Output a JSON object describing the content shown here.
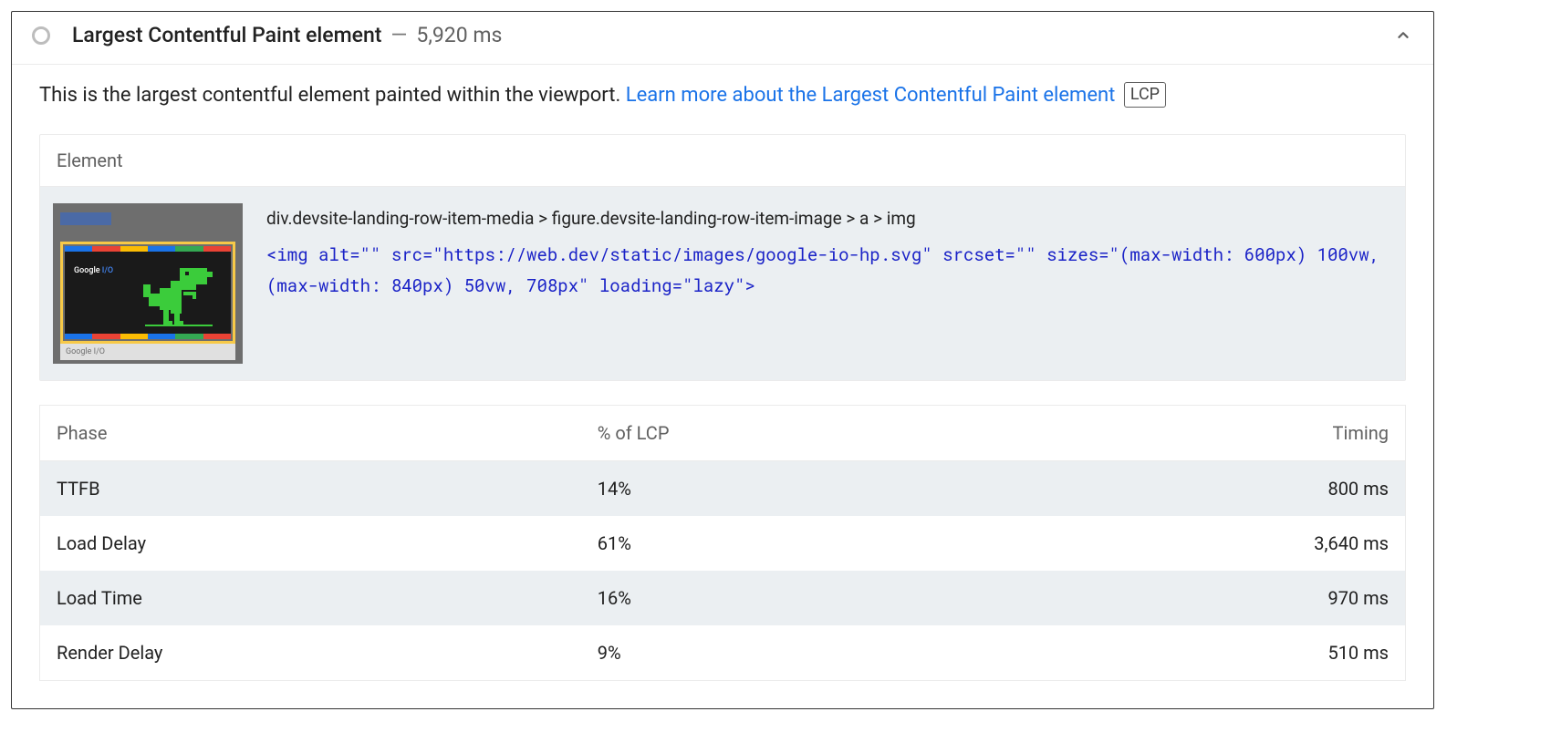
{
  "header": {
    "title": "Largest Contentful Paint element",
    "separator": "—",
    "metric": "5,920 ms"
  },
  "description": {
    "text": "This is the largest contentful element painted within the viewport. ",
    "link_text": "Learn more about the Largest Contentful Paint element",
    "badge": "LCP"
  },
  "element_card": {
    "header": "Element",
    "selector_path": "div.devsite-landing-row-item-media > figure.devsite-landing-row-item-image > a > img",
    "html_snippet": "<img alt=\"\" src=\"https://web.dev/static/images/google-io-hp.svg\" srcset=\"\" sizes=\"(max-width: 600px) 100vw, (max-width: 840px) 50vw, 708px\" loading=\"lazy\">",
    "thumb_logo_text": "Google",
    "thumb_logo_io": " I/O",
    "thumb_caption": "Google I/O"
  },
  "phase_table": {
    "columns": {
      "phase": "Phase",
      "pct": "% of LCP",
      "timing": "Timing"
    },
    "rows": [
      {
        "phase": "TTFB",
        "pct": "14%",
        "timing": "800 ms"
      },
      {
        "phase": "Load Delay",
        "pct": "61%",
        "timing": "3,640 ms"
      },
      {
        "phase": "Load Time",
        "pct": "16%",
        "timing": "970 ms"
      },
      {
        "phase": "Render Delay",
        "pct": "9%",
        "timing": "510 ms"
      }
    ]
  }
}
